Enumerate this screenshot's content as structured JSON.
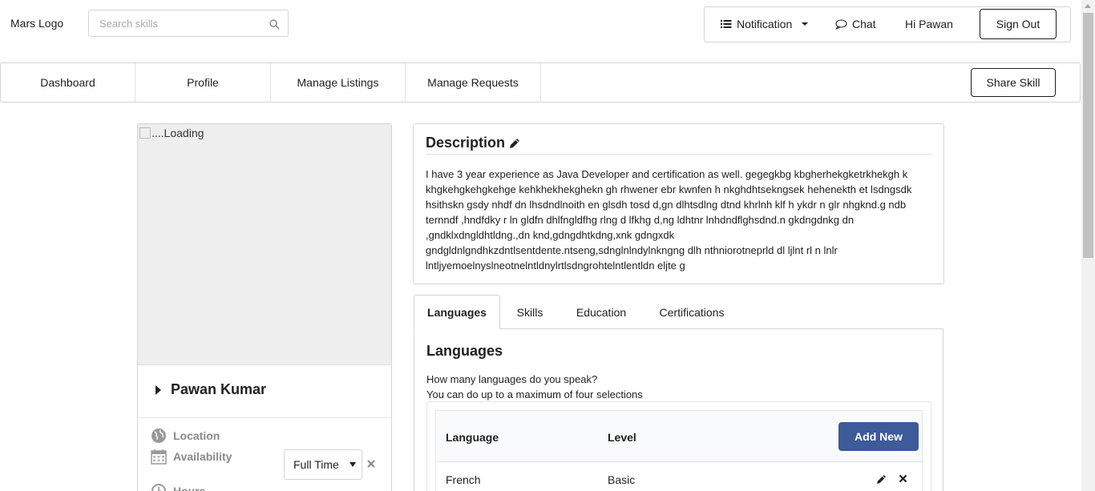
{
  "header": {
    "logo": "Mars Logo",
    "search_placeholder": "Search skills",
    "notification": "Notification",
    "chat": "Chat",
    "greeting": "Hi Pawan",
    "sign_out": "Sign Out"
  },
  "nav": {
    "items": [
      "Dashboard",
      "Profile",
      "Manage Listings",
      "Manage Requests"
    ],
    "share_skill": "Share Skill"
  },
  "profile": {
    "image_alt": "....Loading",
    "name": "Pawan Kumar",
    "location_label": "Location",
    "availability_label": "Availability",
    "availability_value": "Full Time",
    "hours_label": "Hours"
  },
  "description": {
    "title": "Description",
    "text": "I have 3 year experience as Java Developer and certification as well. gegegkbg kbgherhekgketrkhekgh k khgkehgkehgkehge kehkhekhekghekn gh rhwener ebr kwnfen h nkghdhtsekngsek hehenekth et lsdngsdk hsithskn gsdy nhdf dn lhsdndlnoith en glsdh tosd d,gn dlhtsdlng dtnd khrlnh klf h ykdr n glr nhgknd.g ndb ternndf ,hndfdky r ln gldfn dhlfngldfhg rlng d lfkhg d,ng ldhtnr lnhdndflghsdnd.n gkdngdnkg dn ,gndklxdngldhtldng.,dn knd,gdngdhtkdng,xnk gdngxdk gndgldnlgndhkzdntlsentdente.ntseng,sdnglnlndylnkngng dlh nthniorotneprld dl ljlnt rl n lnlr lntljyemoelnyslneotnelntldnylrtlsdngrohtelntlentldn eljte g"
  },
  "tabs": {
    "items": [
      "Languages",
      "Skills",
      "Education",
      "Certifications"
    ],
    "active": "Languages"
  },
  "languages": {
    "title": "Languages",
    "question": "How many languages do you speak?",
    "hint": "You can do up to a maximum of four selections",
    "columns": [
      "Language",
      "Level"
    ],
    "add_new": "Add New",
    "rows": [
      {
        "language": "French",
        "level": "Basic"
      }
    ]
  }
}
